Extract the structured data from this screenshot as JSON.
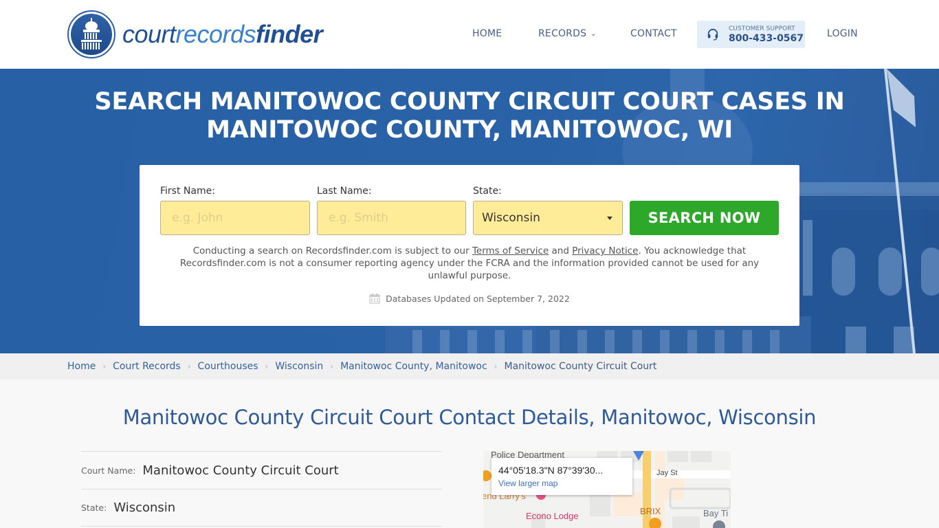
{
  "header": {
    "logo": {
      "part1": "court",
      "part2": "records",
      "part3": "finder"
    },
    "nav": {
      "home": "HOME",
      "records": "RECORDS",
      "contact": "CONTACT",
      "login": "LOGIN"
    },
    "support": {
      "label": "CUSTOMER SUPPORT",
      "phone": "800-433-0567"
    }
  },
  "hero": {
    "title_line1": "SEARCH MANITOWOC COUNTY CIRCUIT COURT CASES IN",
    "title_line2": "MANITOWOC COUNTY, MANITOWOC, WI"
  },
  "search": {
    "first_name_label": "First Name:",
    "first_name_placeholder": "e.g. John",
    "first_name_value": "",
    "last_name_label": "Last Name:",
    "last_name_placeholder": "e.g. Smith",
    "last_name_value": "",
    "state_label": "State:",
    "state_value": "Wisconsin",
    "button": "SEARCH NOW",
    "disclaimer_pre": "Conducting a search on Recordsfinder.com is subject to our ",
    "terms_link": "Terms of Service",
    "disclaimer_and": " and ",
    "privacy_link": "Privacy Notice",
    "disclaimer_post": ". You acknowledge that Recordsfinder.com is not a consumer reporting agency under the FCRA and the information provided cannot be used for any unlawful purpose.",
    "updated": "Databases Updated on September 7, 2022"
  },
  "breadcrumb": [
    "Home",
    "Court Records",
    "Courthouses",
    "Wisconsin",
    "Manitowoc County, Manitowoc",
    "Manitowoc County Circuit Court"
  ],
  "main": {
    "title": "Manitowoc County Circuit Court Contact Details, Manitowoc, Wisconsin",
    "details": [
      {
        "label": "Court Name:",
        "value": "Manitowoc County Circuit Court"
      },
      {
        "label": "State:",
        "value": "Wisconsin"
      }
    ]
  },
  "map": {
    "coords": "44°05'18.3\"N 87°39'30...",
    "link": "View larger map",
    "labels": {
      "police": "Police Department",
      "jay_st": "Jay St",
      "larrys": "end Larry's",
      "econo": "Econo Lodge",
      "brix": "BRIX",
      "bay": "Bay Ti"
    }
  },
  "colors": {
    "brand_blue": "#2a62a8",
    "search_green": "#2ea82b",
    "input_yellow": "#ffec99",
    "heading_blue": "#2f5a9a"
  }
}
